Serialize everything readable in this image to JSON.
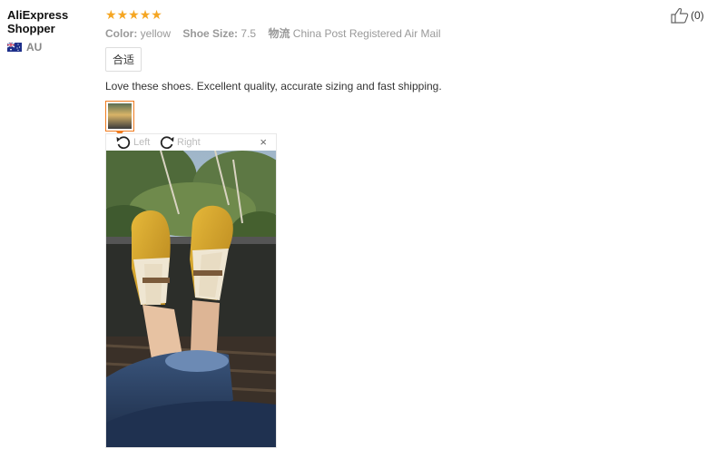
{
  "user": {
    "name": "AliExpress Shopper",
    "country_code": "AU"
  },
  "rating": {
    "stars": 5,
    "max": 5
  },
  "attributes": [
    {
      "key": "Color:",
      "value": "yellow"
    },
    {
      "key": "Shoe Size:",
      "value": "7.5"
    },
    {
      "key": "物流",
      "value": "China Post Registered Air Mail"
    }
  ],
  "tag": "合适",
  "feedback": "Love these shoes. Excellent quality, accurate sizing and fast shipping.",
  "viewer": {
    "rotate_left": "Left",
    "rotate_right": "Right",
    "close": "×"
  },
  "helpful": {
    "count": "(0)"
  },
  "colors": {
    "star": "#f5a623",
    "accent": "#f07b1e"
  }
}
